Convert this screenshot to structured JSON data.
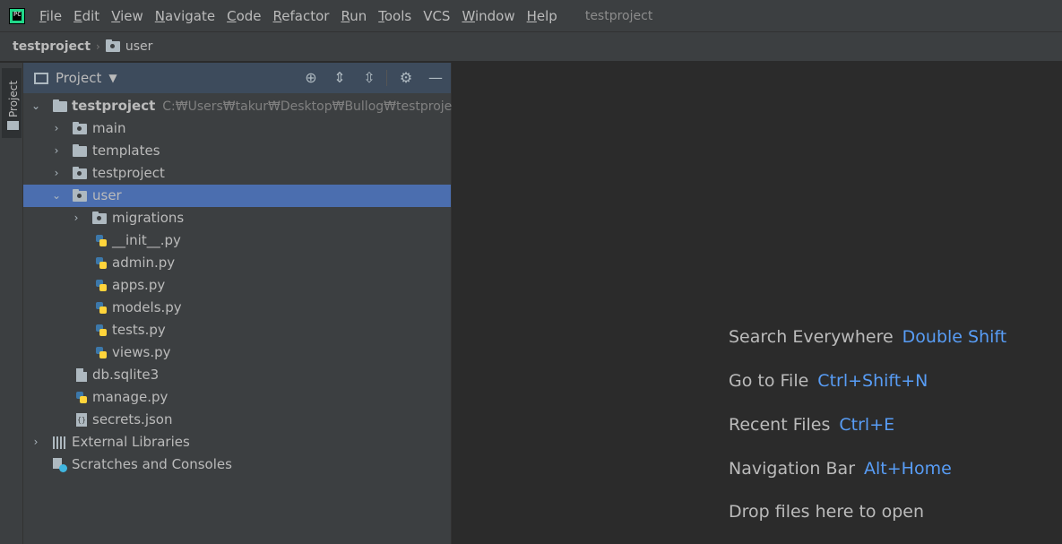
{
  "menubar": {
    "items": [
      {
        "label": "File",
        "mnemonic": "F",
        "rest": "ile"
      },
      {
        "label": "Edit",
        "mnemonic": "E",
        "rest": "dit"
      },
      {
        "label": "View",
        "mnemonic": "V",
        "rest": "iew"
      },
      {
        "label": "Navigate",
        "mnemonic": "N",
        "rest": "avigate"
      },
      {
        "label": "Code",
        "mnemonic": "C",
        "rest": "ode"
      },
      {
        "label": "Refactor",
        "mnemonic": "R",
        "rest": "efactor"
      },
      {
        "label": "Run",
        "mnemonic": "R",
        "rest": "un"
      },
      {
        "label": "Tools",
        "mnemonic": "T",
        "rest": "ools"
      },
      {
        "label": "VCS",
        "mnemonic": "",
        "rest": "VCS"
      },
      {
        "label": "Window",
        "mnemonic": "W",
        "rest": "indow"
      },
      {
        "label": "Help",
        "mnemonic": "H",
        "rest": "elp"
      }
    ],
    "window_title": "testproject",
    "logo_text": "PC"
  },
  "breadcrumb": {
    "root": "testproject",
    "separator": "›",
    "current": "user"
  },
  "tool_strip": {
    "project_label": "Project"
  },
  "project_panel": {
    "title": "Project",
    "dropdown_icon": "caret-down-icon",
    "buttons": {
      "locate": "⊕",
      "expand_all": "⇕",
      "collapse_all": "⇳",
      "settings": "⚙",
      "hide": "—"
    }
  },
  "tree": [
    {
      "label": "testproject",
      "path": "C:₩Users₩takur₩Desktop₩Bullog₩testproject",
      "icon": "folder-icon",
      "expanded": true,
      "bold": true
    },
    {
      "label": "main",
      "icon": "package-folder-icon",
      "expanded": false
    },
    {
      "label": "templates",
      "icon": "folder-icon",
      "expanded": false
    },
    {
      "label": "testproject",
      "icon": "package-folder-icon",
      "expanded": false
    },
    {
      "label": "user",
      "icon": "package-folder-icon",
      "expanded": true,
      "selected": true
    },
    {
      "label": "migrations",
      "icon": "package-folder-icon",
      "expanded": false
    },
    {
      "label": "__init__.py",
      "icon": "python-file-icon"
    },
    {
      "label": "admin.py",
      "icon": "python-file-icon"
    },
    {
      "label": "apps.py",
      "icon": "python-file-icon"
    },
    {
      "label": "models.py",
      "icon": "python-file-icon"
    },
    {
      "label": "tests.py",
      "icon": "python-file-icon"
    },
    {
      "label": "views.py",
      "icon": "python-file-icon"
    },
    {
      "label": "db.sqlite3",
      "icon": "file-icon"
    },
    {
      "label": "manage.py",
      "icon": "python-file-icon"
    },
    {
      "label": "secrets.json",
      "icon": "json-file-icon"
    },
    {
      "label": "External Libraries",
      "icon": "libraries-icon",
      "expanded": false
    },
    {
      "label": "Scratches and Consoles",
      "icon": "scratches-icon"
    }
  ],
  "editor_hints": [
    {
      "text": "Search Everywhere",
      "key": "Double Shift"
    },
    {
      "text": "Go to File",
      "key": "Ctrl+Shift+N"
    },
    {
      "text": "Recent Files",
      "key": "Ctrl+E"
    },
    {
      "text": "Navigation Bar",
      "key": "Alt+Home"
    },
    {
      "text": "Drop files here to open",
      "key": ""
    }
  ],
  "colors": {
    "accent_selection": "#4b6eaf",
    "shortcut_blue": "#589df6",
    "panel_header": "#3d4b5c"
  }
}
